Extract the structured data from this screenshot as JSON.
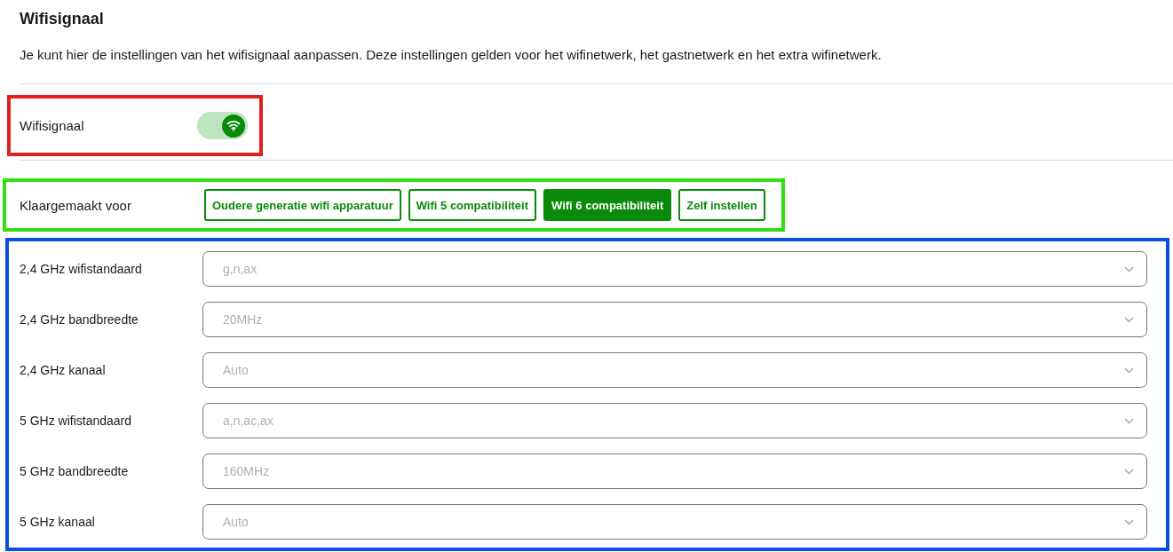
{
  "title": "Wifisignaal",
  "description": "Je kunt hier de instellingen van het wifisignaal aanpassen. Deze instellingen gelden voor het wifinetwerk, het gastnetwerk en het extra wifinetwerk.",
  "sections": [
    {
      "kind": "toggle",
      "color": "#e02020",
      "label": "Wifisignaal",
      "on": true
    },
    {
      "kind": "presets",
      "color": "#33dd11",
      "label": "Klaargemaakt voor",
      "options": [
        {
          "label": "Oudere generatie wifi apparatuur",
          "selected": false
        },
        {
          "label": "Wifi 5 compatibiliteit",
          "selected": false
        },
        {
          "label": "Wifi 6 compatibiliteit",
          "selected": true
        },
        {
          "label": "Zelf instellen",
          "selected": false
        }
      ]
    },
    {
      "kind": "settings",
      "color": "#0a4fe0",
      "settings": [
        {
          "label": "2,4 GHz wifistandaard",
          "value": "g,n,ax",
          "disabled": true
        },
        {
          "label": "2,4 GHz bandbreedte",
          "value": "20MHz",
          "disabled": true
        },
        {
          "label": "2,4 GHz kanaal",
          "value": "Auto",
          "disabled": true
        },
        {
          "label": "5 GHz wifistandaard",
          "value": "a,n,ac,ax",
          "disabled": true
        },
        {
          "label": "5 GHz bandbreedte",
          "value": "160MHz",
          "disabled": true
        },
        {
          "label": "5 GHz kanaal",
          "value": "Auto",
          "disabled": true
        }
      ]
    }
  ]
}
